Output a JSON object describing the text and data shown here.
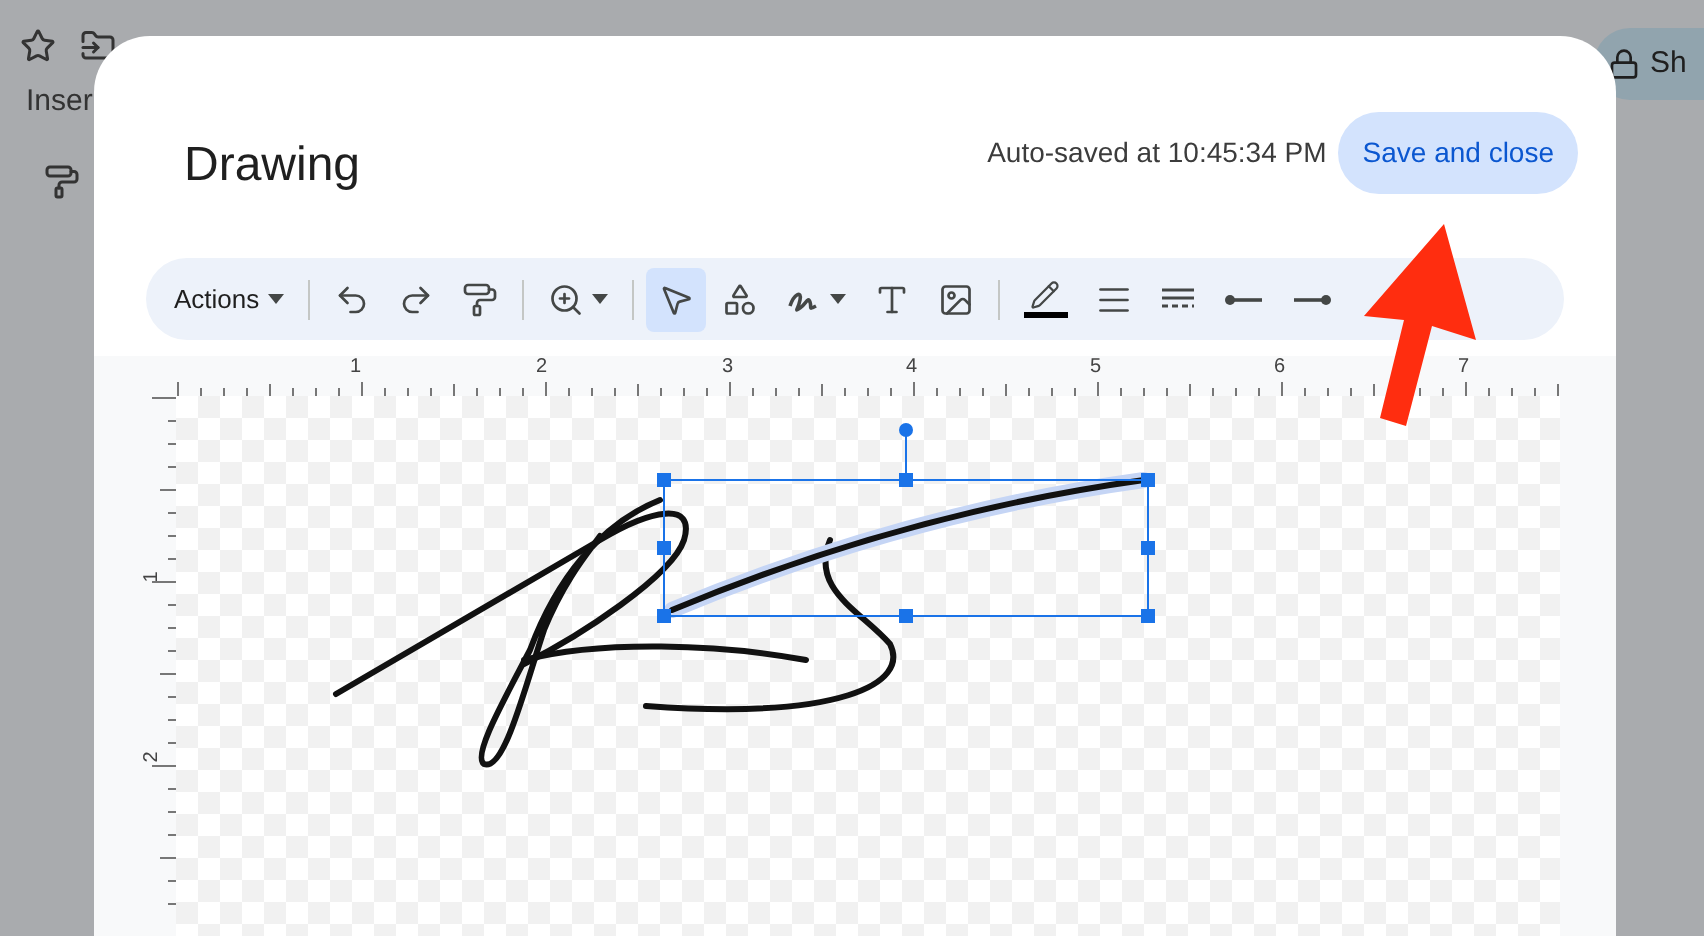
{
  "background": {
    "menu_label": "Inser",
    "share_button": "Sh"
  },
  "dialog": {
    "title": "Drawing",
    "autosave_status": "Auto-saved at 10:45:34 PM",
    "save_button": "Save and close"
  },
  "toolbar": {
    "actions_menu": "Actions",
    "tools": [
      {
        "kind": "undo",
        "selected": false
      },
      {
        "kind": "redo",
        "selected": false
      },
      {
        "kind": "paint-format",
        "selected": false
      },
      {
        "kind": "zoom",
        "selected": false
      },
      {
        "kind": "select",
        "selected": true
      },
      {
        "kind": "shape",
        "selected": false
      },
      {
        "kind": "scribble",
        "selected": false
      },
      {
        "kind": "text",
        "selected": false
      },
      {
        "kind": "image",
        "selected": false
      },
      {
        "kind": "line-color",
        "selected": false
      },
      {
        "kind": "line-weight",
        "selected": false
      },
      {
        "kind": "line-dash",
        "selected": false
      },
      {
        "kind": "line-start",
        "selected": false
      },
      {
        "kind": "line-end",
        "selected": false
      }
    ]
  },
  "ruler": {
    "top_labels": [
      "1",
      "2",
      "3",
      "4",
      "5",
      "6",
      "7"
    ],
    "left_labels": [
      "1",
      "2"
    ]
  }
}
